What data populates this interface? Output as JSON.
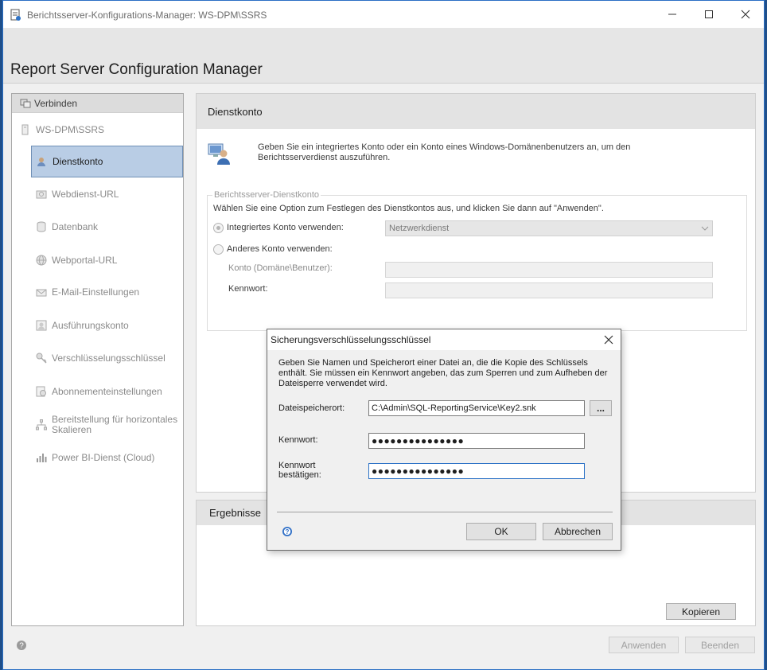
{
  "window": {
    "title": "Berichtsserver-Konfigurations-Manager: WS-DPM\\SSRS",
    "app_title": "Report Server Configuration Manager"
  },
  "sidebar": {
    "connect": "Verbinden",
    "server": "WS-DPM\\SSRS",
    "items": [
      {
        "label": "Dienstkonto",
        "icon": "service-account-icon",
        "active": true
      },
      {
        "label": "Webdienst-URL",
        "icon": "webservice-icon"
      },
      {
        "label": "Datenbank",
        "icon": "database-icon"
      },
      {
        "label": "Webportal-URL",
        "icon": "globe-icon"
      },
      {
        "label": "E-Mail-Einstellungen",
        "icon": "email-icon"
      },
      {
        "label": "Ausführungskonto",
        "icon": "execution-account-icon"
      },
      {
        "label": "Verschlüsselungsschlüssel",
        "icon": "key-icon"
      },
      {
        "label": "Abonnementeinstellungen",
        "icon": "subscription-icon"
      },
      {
        "label": "Bereitstellung für horizontales Skalieren",
        "icon": "scaleout-icon"
      },
      {
        "label": "Power BI-Dienst (Cloud)",
        "icon": "powerbi-icon"
      }
    ]
  },
  "content": {
    "heading": "Dienstkonto",
    "intro": "Geben Sie ein integriertes Konto oder ein Konto eines Windows-Domänenbenutzers an, um den Berichtsserverdienst auszuführen.",
    "group_legend": "Berichtsserver-Dienstkonto",
    "instruction": "Wählen Sie eine Option zum Festlegen des Dienstkontos aus, und klicken Sie dann auf \"Anwenden\".",
    "radio_builtin": "Integriertes Konto verwenden:",
    "builtin_value": "Netzwerkdienst",
    "radio_other": "Anderes Konto verwenden:",
    "account_label": "Konto (Domäne\\Benutzer):",
    "password_label": "Kennwort:"
  },
  "results": {
    "heading": "Ergebnisse",
    "copy_button": "Kopieren"
  },
  "footer": {
    "apply_button": "Anwenden",
    "exit_button": "Beenden"
  },
  "dialog": {
    "title": "Sicherungsverschlüsselungsschlüssel",
    "description": "Geben Sie Namen und Speicherort einer Datei an, die die Kopie des Schlüssels enthält. Sie müssen ein Kennwort angeben, das zum Sperren und zum Aufheben der Dateisperre verwendet wird.",
    "file_label": "Dateispeicherort:",
    "file_value": "C:\\Admin\\SQL-ReportingService\\Key2.snk",
    "browse_button": "...",
    "password_label": "Kennwort:",
    "password_value": "●●●●●●●●●●●●●●●",
    "confirm_label_1": "Kennwort",
    "confirm_label_2": "bestätigen:",
    "confirm_value": "●●●●●●●●●●●●●●●",
    "ok_button": "OK",
    "cancel_button": "Abbrechen"
  },
  "colors": {
    "selection": "#b9cde5",
    "focus_border": "#2e73c7",
    "desktop": "#1f4f8a"
  }
}
